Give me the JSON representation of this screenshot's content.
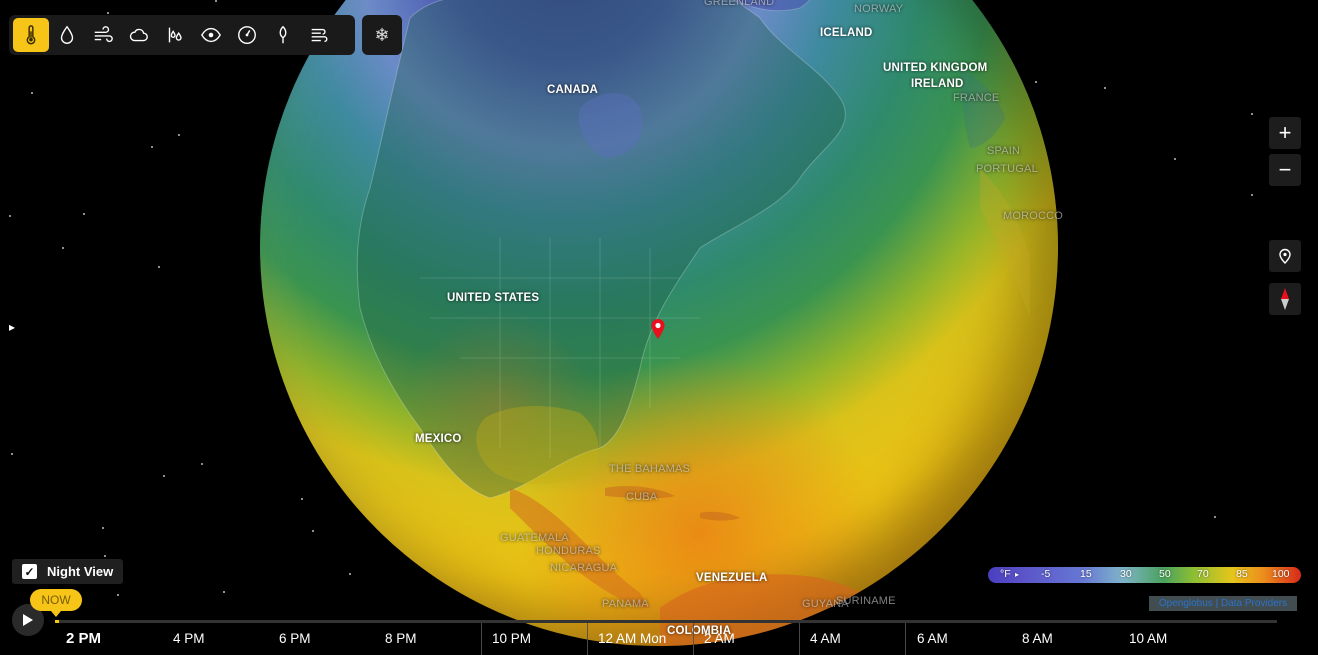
{
  "toolbar": {
    "tools": [
      {
        "icon": "thermometer-icon",
        "active": true
      },
      {
        "icon": "droplet-icon",
        "active": false
      },
      {
        "icon": "wind-icon",
        "active": false
      },
      {
        "icon": "cloud-icon",
        "active": false
      },
      {
        "icon": "rain-icon",
        "active": false
      },
      {
        "icon": "eye-icon",
        "active": false
      },
      {
        "icon": "gauge-icon",
        "active": false
      },
      {
        "icon": "pollen-icon",
        "active": false
      },
      {
        "icon": "waves-icon",
        "active": false
      }
    ],
    "extra_icon": "snowflake-icon",
    "extra_glyph": "❄"
  },
  "map_labels": {
    "greenland": "GREENLAND",
    "norway": "NORWAY",
    "iceland": "ICELAND",
    "canada": "CANADA",
    "uk": "UNITED KINGDOM",
    "ireland": "IRELAND",
    "france": "FRANCE",
    "spain": "SPAIN",
    "portugal": "PORTUGAL",
    "morocco": "MOROCCO",
    "usa": "UNITED STATES",
    "mexico": "MEXICO",
    "bahamas": "THE BAHAMAS",
    "cuba": "CUBA",
    "guatemala": "GUATEMALA",
    "honduras": "HONDURAS",
    "nicaragua": "NICARAGUA",
    "panama": "PANAMA",
    "venezuela": "VENEZUELA",
    "guyana": "GUYANA",
    "suriname": "SURINAME",
    "colombia": "COLOMBIA"
  },
  "controls": {
    "zoom_in": "+",
    "zoom_out": "−",
    "location_icon": "location-pin-icon",
    "compass_icon": "compass-icon",
    "left_toggle": "▸"
  },
  "night_view": {
    "label": "Night View",
    "checked": true,
    "check_glyph": "✓"
  },
  "legend": {
    "unit": "°F",
    "unit_arrow": "▸",
    "values": [
      "-5",
      "15",
      "30",
      "50",
      "70",
      "85",
      "100"
    ]
  },
  "credits": {
    "text": "Openglobus | Data Providers"
  },
  "timeline": {
    "now_label": "NOW",
    "times": [
      "2 PM",
      "4 PM",
      "6 PM",
      "8 PM",
      "10 PM",
      "12 AM Mon",
      "2 AM",
      "4 AM",
      "6 AM",
      "8 AM",
      "10 AM"
    ]
  },
  "colors": {
    "accent": "#f7c518",
    "pin": "#e8101c",
    "panel": "#1a1a1a"
  }
}
